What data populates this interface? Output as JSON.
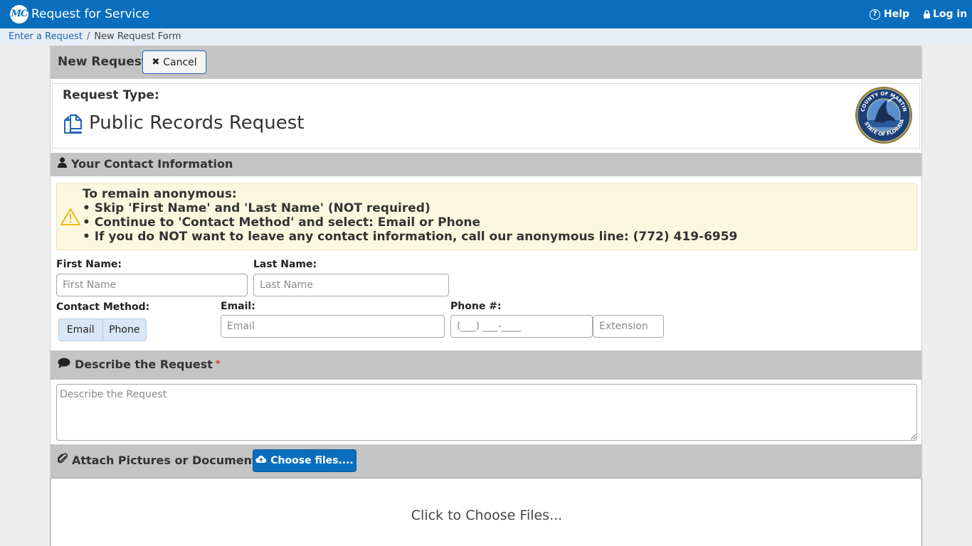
{
  "header": {
    "logo_text": "MC",
    "title": "Request for Service",
    "help_label": "Help",
    "login_label": "Log in",
    "accent": "#0a6ebd"
  },
  "breadcrumb": {
    "items": [
      "Enter a Request",
      "New Request Form"
    ],
    "separator": "/"
  },
  "panel": {
    "title": "New Request",
    "cancel_label": "Cancel",
    "cancel_icon": "times-icon"
  },
  "request_type": {
    "label": "Request Type:",
    "value": "Public Records Request",
    "icon": "copy-documents-icon",
    "seal": {
      "top_text": "COUNTY OF MARTIN",
      "bottom_text": "STATE OF FLORIDA"
    }
  },
  "contact": {
    "section_title": "Your Contact Information",
    "section_icon": "user-icon",
    "notice": {
      "icon": "warning-triangle-icon",
      "lines": [
        "To remain anonymous:",
        "• Skip 'First Name' and 'Last Name' (NOT required)",
        "• Continue to 'Contact Method' and select: Email or Phone",
        "• If you do NOT want to leave any contact information, call our anonymous line: (772) 419-6959"
      ]
    },
    "first_name": {
      "label": "First Name:",
      "placeholder": "First Name",
      "value": ""
    },
    "last_name": {
      "label": "Last Name:",
      "placeholder": "Last Name",
      "value": ""
    },
    "contact_method": {
      "label": "Contact Method:",
      "options": [
        "Email",
        "Phone"
      ]
    },
    "email": {
      "label": "Email:",
      "placeholder": "Email",
      "value": ""
    },
    "phone": {
      "label": "Phone #:",
      "placeholder": "(___) ___-____",
      "value": ""
    },
    "extension": {
      "placeholder": "Extension",
      "value": ""
    }
  },
  "describe": {
    "section_title": "Describe the Request",
    "section_icon": "comment-icon",
    "required_mark": "*",
    "placeholder": "Describe the Request",
    "value": ""
  },
  "attach": {
    "section_title": "Attach Pictures or Documents",
    "section_icon": "paperclip-icon",
    "choose_label": "Choose files....",
    "choose_icon": "cloud-upload-icon",
    "dropzone_text": "Click to Choose Files..."
  }
}
